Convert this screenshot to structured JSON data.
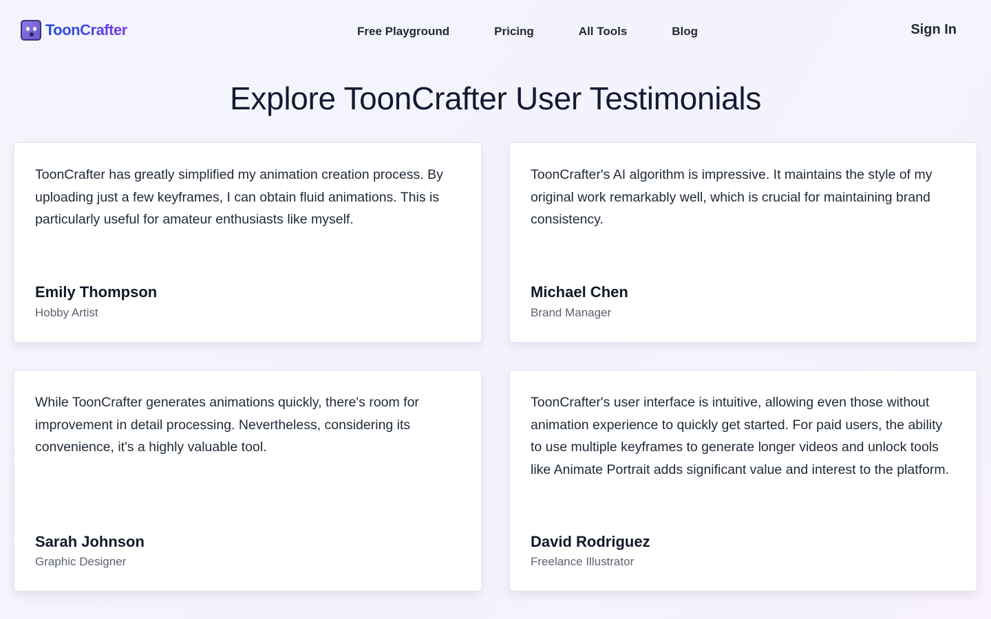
{
  "brand": {
    "name": "ToonCrafter",
    "logo_icon": "tooncrafter-face-icon"
  },
  "nav": {
    "items": [
      {
        "label": "Free Playground"
      },
      {
        "label": "Pricing"
      },
      {
        "label": "All Tools"
      },
      {
        "label": "Blog"
      }
    ],
    "sign_in": "Sign In"
  },
  "page": {
    "title": "Explore ToonCrafter User Testimonials"
  },
  "testimonials": [
    {
      "quote": "ToonCrafter has greatly simplified my animation creation process. By uploading just a few keyframes, I can obtain fluid animations. This is particularly useful for amateur enthusiasts like myself.",
      "name": "Emily Thompson",
      "role": "Hobby Artist"
    },
    {
      "quote": "ToonCrafter's AI algorithm is impressive. It maintains the style of my original work remarkably well, which is crucial for maintaining brand consistency.",
      "name": "Michael Chen",
      "role": "Brand Manager"
    },
    {
      "quote": "While ToonCrafter generates animations quickly, there's room for improvement in detail processing. Nevertheless, considering its convenience, it's a highly valuable tool.",
      "name": "Sarah Johnson",
      "role": "Graphic Designer"
    },
    {
      "quote": "ToonCrafter's user interface is intuitive, allowing even those without animation experience to quickly get started. For paid users, the ability to use multiple keyframes to generate longer videos and unlock tools like Animate Portrait adds significant value and interest to the platform.",
      "name": "David Rodriguez",
      "role": "Freelance Illustrator"
    }
  ],
  "colors": {
    "brand_gradient_start": "#1d4ed8",
    "brand_gradient_end": "#7c3aed",
    "heading": "#141a33"
  }
}
